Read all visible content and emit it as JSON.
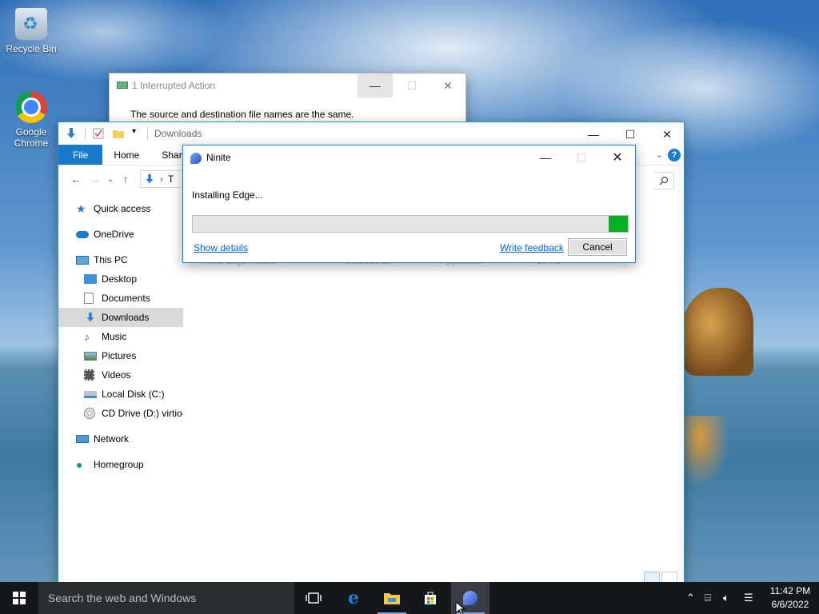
{
  "desktop": {
    "icons": [
      {
        "label": "Recycle Bin"
      },
      {
        "label": "Google Chrome"
      }
    ]
  },
  "interrupted": {
    "title": "1 Interrupted Action",
    "message": "The source and destination file names are the same."
  },
  "explorer": {
    "title": "Downloads",
    "ribbon_tabs": [
      "File",
      "Home",
      "Share"
    ],
    "address_fragment": "T",
    "nav": {
      "quick_access": "Quick access",
      "onedrive": "OneDrive",
      "this_pc": "This PC",
      "desktop": "Desktop",
      "documents": "Documents",
      "downloads": "Downloads",
      "music": "Music",
      "pictures": "Pictures",
      "videos": "Videos",
      "local_disk": "Local Disk (C:)",
      "cd_drive": "CD Drive (D:) virtio-",
      "network": "Network",
      "homegroup": "Homegroup"
    },
    "selected_nav": "Downloads",
    "file_row": {
      "name": "Ninite Edge Installer",
      "date": "6/6/2022 11:",
      "type": "Application",
      "size": "413 KB"
    }
  },
  "ninite": {
    "title": "Ninite",
    "status": "Installing Edge...",
    "progress_fraction": 0.045,
    "show_details": "Show details",
    "write_feedback": "Write feedback",
    "cancel": "Cancel"
  },
  "taskbar": {
    "search_placeholder": "Search the web and Windows",
    "time": "11:42 PM",
    "date": "6/6/2022"
  },
  "colors": {
    "accent": "#1979ca",
    "progress": "#06b025",
    "link": "#0066cc",
    "taskbar": "#14171b"
  }
}
